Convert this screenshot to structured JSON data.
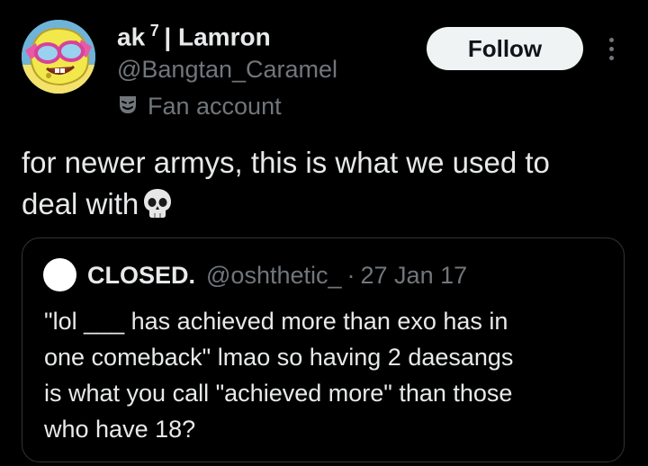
{
  "author": {
    "name": "ak",
    "name_superscript": "7",
    "name_suffix": "| Lamron",
    "handle": "@Bangtan_Caramel",
    "label": "Fan account",
    "label_icon": "theater-mask-icon"
  },
  "actions": {
    "follow_label": "Follow",
    "more_icon": "more-vertical-icon"
  },
  "tweet": {
    "text_lines": [
      "for newer armys, this is what we used to",
      "deal with"
    ],
    "emoji": "skull-emoji"
  },
  "quoted_tweet": {
    "name": "CLOSED.",
    "handle": "@oshthetic_",
    "separator": "·",
    "date": "27 Jan 17",
    "text_lines": [
      "\"lol ___ has achieved more than exo has in",
      "one comeback\"  lmao so having 2 daesangs",
      "is what you call \"achieved more\" than those",
      "who have 18?"
    ]
  },
  "colors": {
    "background": "#000000",
    "primary_text": "#e7e9ea",
    "secondary_text": "#71767b",
    "border": "#2f3336",
    "follow_bg": "#eff3f4"
  }
}
